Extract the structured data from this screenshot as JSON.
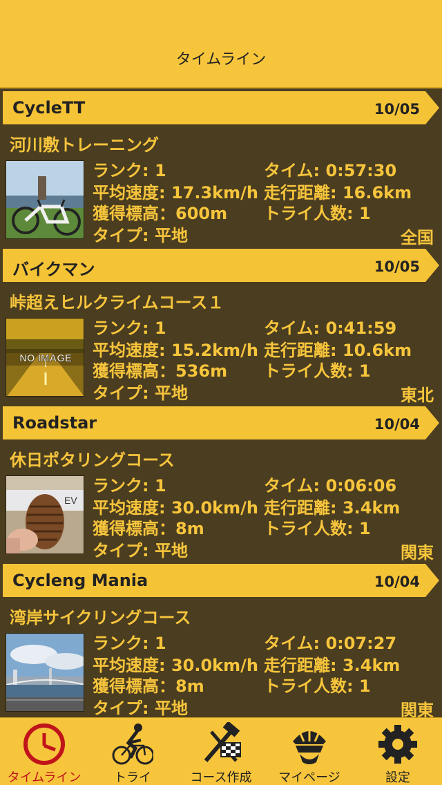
{
  "header": {
    "title": "タイムライン"
  },
  "entries": [
    {
      "user": "CycleTT",
      "date": "10/05",
      "course": "河川敷トレーニング",
      "rank": "ランク: 1",
      "time": "タイム: 0:57:30",
      "avg_speed": "平均速度: 17.3km/h",
      "distance": "走行距離: 16.6km",
      "elevation": "獲得標高：600m",
      "tries": "トライ人数: 1",
      "type": "タイプ: 平地",
      "region": "全国"
    },
    {
      "user": "バイクマン",
      "date": "10/05",
      "course": "峠超えヒルクライムコース１",
      "rank": "ランク: 1",
      "time": "タイム: 0:41:59",
      "avg_speed": "平均速度: 15.2km/h",
      "distance": "走行距離: 10.6km",
      "elevation": "獲得標高：536m",
      "tries": "トライ人数: 1",
      "type": "タイプ: 平地",
      "region": "東北",
      "thumb_text": "NO IMAGE"
    },
    {
      "user": "Roadstar",
      "date": "10/04",
      "course": "休日ポタリングコース",
      "rank": "ランク: 1",
      "time": "タイム: 0:06:06",
      "avg_speed": "平均速度: 30.0km/h",
      "distance": "走行距離: 3.4km",
      "elevation": "獲得標高：8m",
      "tries": "トライ人数: 1",
      "type": "タイプ: 平地",
      "region": "関東"
    },
    {
      "user": "Cycleng Mania",
      "date": "10/04",
      "course": "湾岸サイクリングコース",
      "rank": "ランク: 1",
      "time": "タイム: 0:07:27",
      "avg_speed": "平均速度: 30.0km/h",
      "distance": "走行距離: 3.4km",
      "elevation": "獲得標高：8m",
      "tries": "トライ人数: 1",
      "type": "タイプ: 平地",
      "region": "関東"
    }
  ],
  "tabs": [
    {
      "label": "タイムライン",
      "icon": "clock-icon",
      "active": true
    },
    {
      "label": "トライ",
      "icon": "cyclist-icon",
      "active": false
    },
    {
      "label": "コース作成",
      "icon": "tools-flag-icon",
      "active": false
    },
    {
      "label": "マイページ",
      "icon": "helmet-rider-icon",
      "active": false
    },
    {
      "label": "設定",
      "icon": "gear-icon",
      "active": false
    }
  ],
  "colors": {
    "accent": "#f7c53c",
    "background": "#4a3d20",
    "active_tab": "#c0141a"
  }
}
